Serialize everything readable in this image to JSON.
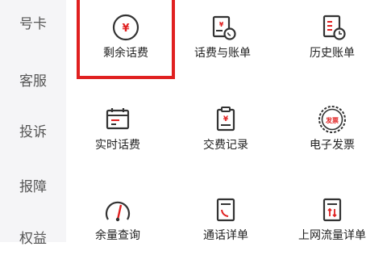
{
  "accent_color": "#e02020",
  "icon_stroke_color": "#333333",
  "sidebar": {
    "items": [
      {
        "label": "号卡"
      },
      {
        "label": "客服"
      },
      {
        "label": "投诉"
      },
      {
        "label": "报障"
      },
      {
        "label": "权益"
      }
    ]
  },
  "grid": {
    "items": [
      {
        "label": "剩余话费",
        "icon": "yen-coin-icon",
        "highlighted": true
      },
      {
        "label": "话费与账单",
        "icon": "bill-with-phone-icon"
      },
      {
        "label": "历史账单",
        "icon": "bill-history-icon"
      },
      {
        "label": "实时话费",
        "icon": "calendar-bill-icon"
      },
      {
        "label": "交费记录",
        "icon": "clipboard-yen-icon"
      },
      {
        "label": "电子发票",
        "icon": "invoice-badge-icon",
        "badge_text": "发票"
      },
      {
        "label": "余量查询",
        "icon": "gauge-icon"
      },
      {
        "label": "通话详单",
        "icon": "call-detail-icon"
      },
      {
        "label": "上网流量详单",
        "icon": "data-detail-icon"
      }
    ]
  }
}
